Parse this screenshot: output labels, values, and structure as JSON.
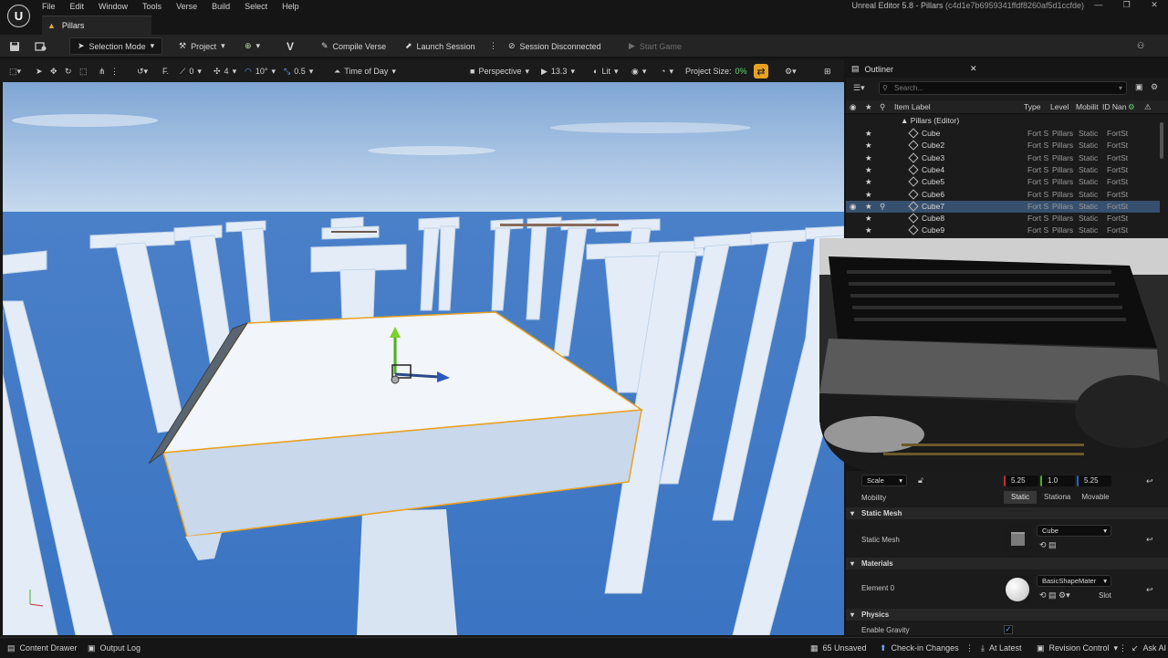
{
  "app": {
    "menu": [
      "File",
      "Edit",
      "Window",
      "Tools",
      "Verse",
      "Build",
      "Select",
      "Help"
    ],
    "level_tab": "Pillars",
    "title_prefix": "Unreal Editor 5.8 - Pillars",
    "title_hash": "(c4d1e7b6959341ffdf8260af5d1ccfde)"
  },
  "toolbar": {
    "selection_mode": "Selection Mode",
    "project": "Project",
    "compile_verse": "Compile Verse",
    "launch_session": "Launch Session",
    "session_status": "Session Disconnected",
    "start_game": "Start Game"
  },
  "viewport_toolbar": {
    "rotate_snap_count": "0",
    "scale_count": "4",
    "angle_snap": "10°",
    "scale_snap": "0.5",
    "time_of_day": "Time of Day",
    "perspective": "Perspective",
    "camera_speed": "13.3",
    "lit": "Lit",
    "project_size_label": "Project Size:",
    "project_size_value": "0%"
  },
  "outliner": {
    "tab": "Outliner",
    "search_placeholder": "Search...",
    "columns": {
      "label": "Item Label",
      "type": "Type",
      "level": "Level",
      "mobility": "Mobilit",
      "id": "ID Nan"
    },
    "root": "Pillars (Editor)",
    "rows": [
      {
        "label": "Cube",
        "type": "Fort S",
        "level": "Pillars",
        "mobility": "Static",
        "id": "FortSt",
        "selected": false
      },
      {
        "label": "Cube2",
        "type": "Fort S",
        "level": "Pillars",
        "mobility": "Static",
        "id": "FortSt",
        "selected": false
      },
      {
        "label": "Cube3",
        "type": "Fort S",
        "level": "Pillars",
        "mobility": "Static",
        "id": "FortSt",
        "selected": false
      },
      {
        "label": "Cube4",
        "type": "Fort S",
        "level": "Pillars",
        "mobility": "Static",
        "id": "FortSt",
        "selected": false
      },
      {
        "label": "Cube5",
        "type": "Fort S",
        "level": "Pillars",
        "mobility": "Static",
        "id": "FortSt",
        "selected": false
      },
      {
        "label": "Cube6",
        "type": "Fort S",
        "level": "Pillars",
        "mobility": "Static",
        "id": "FortSt",
        "selected": false
      },
      {
        "label": "Cube7",
        "type": "Fort S",
        "level": "Pillars",
        "mobility": "Static",
        "id": "FortSt",
        "selected": true
      },
      {
        "label": "Cube8",
        "type": "Fort S",
        "level": "Pillars",
        "mobility": "Static",
        "id": "FortSt",
        "selected": false
      },
      {
        "label": "Cube9",
        "type": "Fort S",
        "level": "Pillars",
        "mobility": "Static",
        "id": "FortSt",
        "selected": false
      }
    ]
  },
  "details": {
    "scale_mode": "Scale",
    "scale": [
      "5.25",
      "1.0",
      "5.25"
    ],
    "mobility_label": "Mobility",
    "mobility_options": [
      "Static",
      "Stationa",
      "Movable"
    ],
    "static_mesh_section": "Static Mesh",
    "static_mesh_label": "Static Mesh",
    "static_mesh_value": "Cube",
    "materials_section": "Materials",
    "element0_label": "Element 0",
    "material_value": "BasicShapeMater",
    "slot_label": "Slot",
    "physics_section": "Physics",
    "enable_gravity": "Enable Gravity"
  },
  "statusbar": {
    "content_drawer": "Content Drawer",
    "output_log": "Output Log",
    "unsaved": "65 Unsaved",
    "checkin": "Check-in Changes",
    "at_latest": "At Latest",
    "revision": "Revision Control",
    "ask_ai": "Ask AI"
  },
  "colors": {
    "accent": "#e8a222",
    "selection": "#37506e",
    "sky": "#9bbfe0",
    "ocean": "#3f7ac6"
  }
}
